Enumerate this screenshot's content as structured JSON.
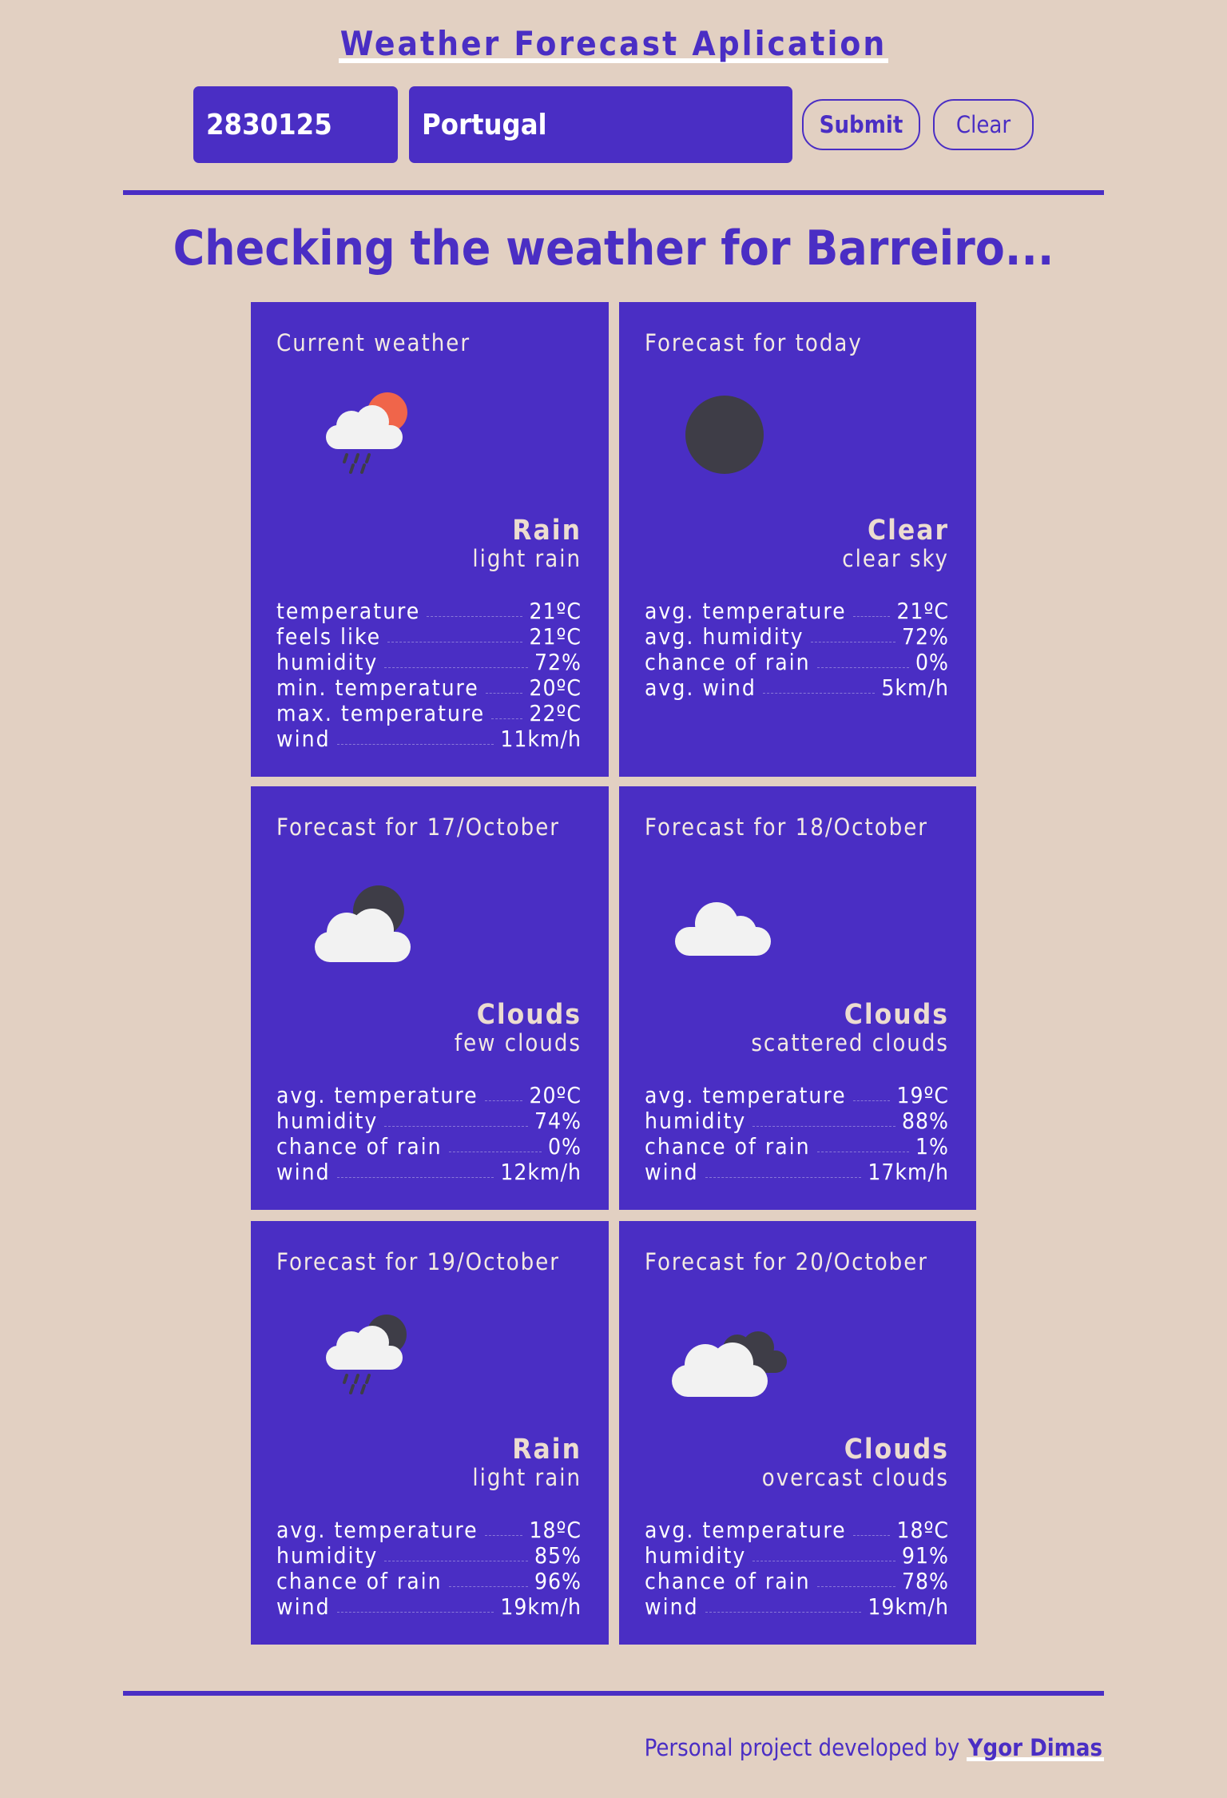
{
  "header": {
    "title": "Weather Forecast Aplication"
  },
  "search": {
    "zip_value": "2830125",
    "country_value": "Portugal",
    "submit_label": "Submit",
    "clear_label": "Clear"
  },
  "status": {
    "heading": "Checking the weather for Barreiro..."
  },
  "cards": [
    {
      "title": "Current weather",
      "icon": "rain-sun-icon",
      "main": "Rain",
      "desc": "light rain",
      "stats": [
        {
          "label": "temperature",
          "value": "21ºC"
        },
        {
          "label": "feels like",
          "value": "21ºC"
        },
        {
          "label": "humidity",
          "value": "72%"
        },
        {
          "label": "min. temperature",
          "value": "20ºC"
        },
        {
          "label": "max. temperature",
          "value": "22ºC"
        },
        {
          "label": "wind",
          "value": "11km/h"
        }
      ]
    },
    {
      "title": "Forecast for today",
      "icon": "clear-night-icon",
      "main": "Clear",
      "desc": "clear sky",
      "stats": [
        {
          "label": "avg. temperature",
          "value": "21ºC"
        },
        {
          "label": "avg. humidity",
          "value": "72%"
        },
        {
          "label": "chance of rain",
          "value": "0%"
        },
        {
          "label": "avg. wind",
          "value": "5km/h"
        }
      ]
    },
    {
      "title": "Forecast for 17/October",
      "icon": "few-clouds-night-icon",
      "main": "Clouds",
      "desc": "few clouds",
      "stats": [
        {
          "label": "avg. temperature",
          "value": "20ºC"
        },
        {
          "label": "humidity",
          "value": "74%"
        },
        {
          "label": "chance of rain",
          "value": "0%"
        },
        {
          "label": "wind",
          "value": "12km/h"
        }
      ]
    },
    {
      "title": "Forecast for 18/October",
      "icon": "cloud-icon",
      "main": "Clouds",
      "desc": "scattered clouds",
      "stats": [
        {
          "label": "avg. temperature",
          "value": "19ºC"
        },
        {
          "label": "humidity",
          "value": "88%"
        },
        {
          "label": "chance of rain",
          "value": "1%"
        },
        {
          "label": "wind",
          "value": "17km/h"
        }
      ]
    },
    {
      "title": "Forecast for 19/October",
      "icon": "rain-night-icon",
      "main": "Rain",
      "desc": "light rain",
      "stats": [
        {
          "label": "avg. temperature",
          "value": "18ºC"
        },
        {
          "label": "humidity",
          "value": "85%"
        },
        {
          "label": "chance of rain",
          "value": "96%"
        },
        {
          "label": "wind",
          "value": "19km/h"
        }
      ]
    },
    {
      "title": "Forecast for 20/October",
      "icon": "overcast-clouds-icon",
      "main": "Clouds",
      "desc": "overcast clouds",
      "stats": [
        {
          "label": "avg. temperature",
          "value": "18ºC"
        },
        {
          "label": "humidity",
          "value": "91%"
        },
        {
          "label": "chance of rain",
          "value": "78%"
        },
        {
          "label": "wind",
          "value": "19km/h"
        }
      ]
    }
  ],
  "footer": {
    "prefix": "Personal project developed by ",
    "author": "Ygor Dimas"
  },
  "colors": {
    "background": "#e2d0c2",
    "accent": "#4a2ec4",
    "sun": "#f0654a",
    "moon": "#3e3d47",
    "cloud": "#f2f2f2"
  }
}
